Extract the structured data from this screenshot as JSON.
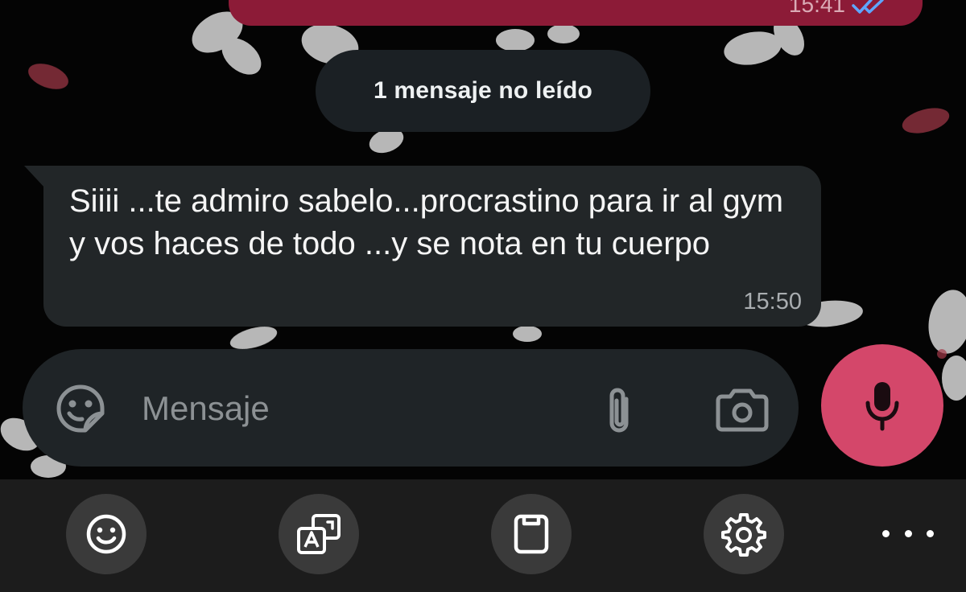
{
  "chat": {
    "previous_message": {
      "time": "15:41",
      "status_icon": "double-check-icon",
      "bubble_color": "#8c1b37"
    },
    "unread_separator": "1 mensaje no leído",
    "incoming_message": {
      "text": "Siiii ...te admiro sabelo...procrastino para ir al gym y vos haces de todo ...y se nota en tu cuerpo",
      "time": "15:50",
      "bubble_color": "#222628"
    }
  },
  "composer": {
    "placeholder": "Mensaje",
    "emoji_icon": "sticker-emoji-icon",
    "attach_icon": "paperclip-icon",
    "camera_icon": "camera-icon",
    "mic_icon": "microphone-icon",
    "accent_color": "#d4476a"
  },
  "keyboard_toolbar": {
    "items": [
      {
        "icon": "smiley-icon"
      },
      {
        "icon": "translate-icon"
      },
      {
        "icon": "clipboard-icon"
      },
      {
        "icon": "settings-gear-icon"
      },
      {
        "icon": "more-options-icon"
      }
    ]
  }
}
